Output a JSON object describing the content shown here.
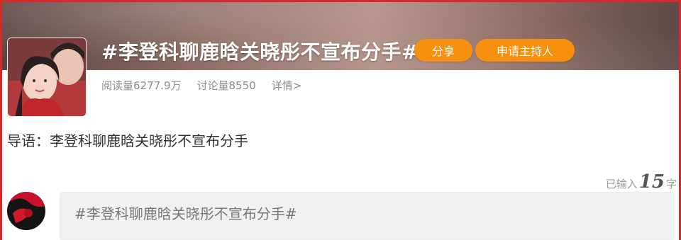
{
  "topic": {
    "title": "#李登科聊鹿晗关晓彤不宣布分手#",
    "share_label": "分享",
    "host_label": "申请主持人",
    "reads_label": "阅读量6277.9万",
    "discussions_label": "讨论量8550",
    "details_label": "详情>"
  },
  "guide": {
    "text": "导语：李登科聊鹿晗关晓彤不宣布分手"
  },
  "composer": {
    "counter_prefix": "已输入",
    "counter_value": "15",
    "counter_suffix": "字",
    "input_text": "#李登科聊鹿晗关晓彤不宣布分手#"
  },
  "colors": {
    "accent_orange": "#f7900f",
    "frame_red": "#d42a2a"
  }
}
